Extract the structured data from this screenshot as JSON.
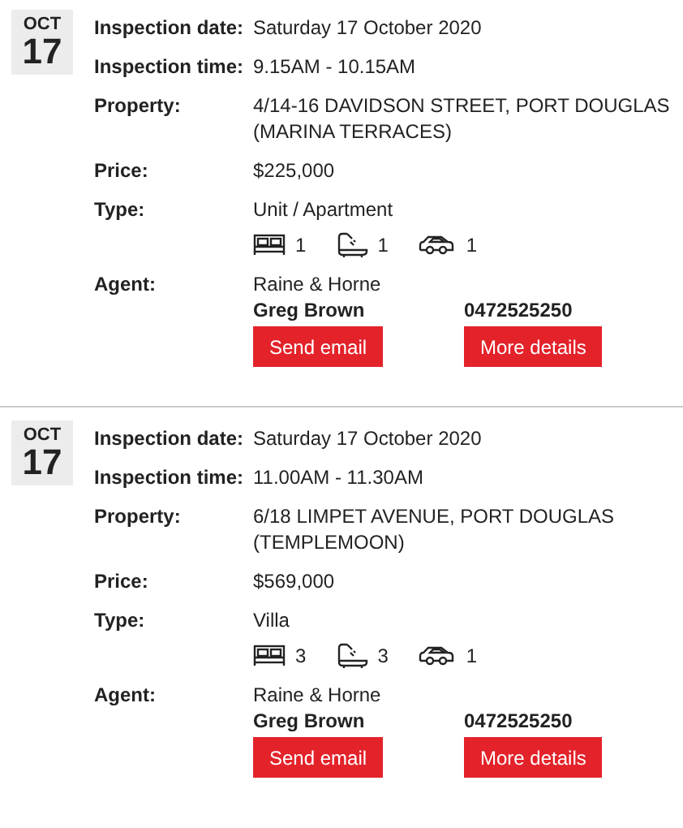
{
  "listings": [
    {
      "month": "OCT",
      "day": "17",
      "rows": [
        {
          "label": "Inspection date:",
          "value": "Saturday 17 October 2020"
        },
        {
          "label": "Inspection time:",
          "value": "9.15AM - 10.15AM"
        },
        {
          "label": "Property:",
          "value": "4/14-16 DAVIDSON STREET, PORT DOUGLAS (MARINA TERRACES)"
        },
        {
          "label": "Price:",
          "value": "$225,000"
        }
      ],
      "type_label": "Type:",
      "type": "Unit / Apartment",
      "features": [
        {
          "kind": "bed",
          "count": "1"
        },
        {
          "kind": "bath",
          "count": "1"
        },
        {
          "kind": "car",
          "count": "1"
        }
      ],
      "agent_label": "Agent:",
      "agency": "Raine & Horne",
      "agent_name": "Greg Brown",
      "phone": "0472525250",
      "buttons": [
        "Send email",
        "More details"
      ]
    },
    {
      "month": "OCT",
      "day": "17",
      "rows": [
        {
          "label": "Inspection date:",
          "value": "Saturday 17 October 2020"
        },
        {
          "label": "Inspection time:",
          "value": "11.00AM - 11.30AM"
        },
        {
          "label": "Property:",
          "value": "6/18 LIMPET AVENUE, PORT DOUGLAS (TEMPLEMOON)"
        },
        {
          "label": "Price:",
          "value": "$569,000"
        }
      ],
      "type_label": "Type:",
      "type": "Villa",
      "features": [
        {
          "kind": "bed",
          "count": "3"
        },
        {
          "kind": "bath",
          "count": "3"
        },
        {
          "kind": "car",
          "count": "1"
        }
      ],
      "agent_label": "Agent:",
      "agency": "Raine & Horne",
      "agent_name": "Greg Brown",
      "phone": "0472525250",
      "buttons": [
        "Send email",
        "More details"
      ]
    }
  ]
}
